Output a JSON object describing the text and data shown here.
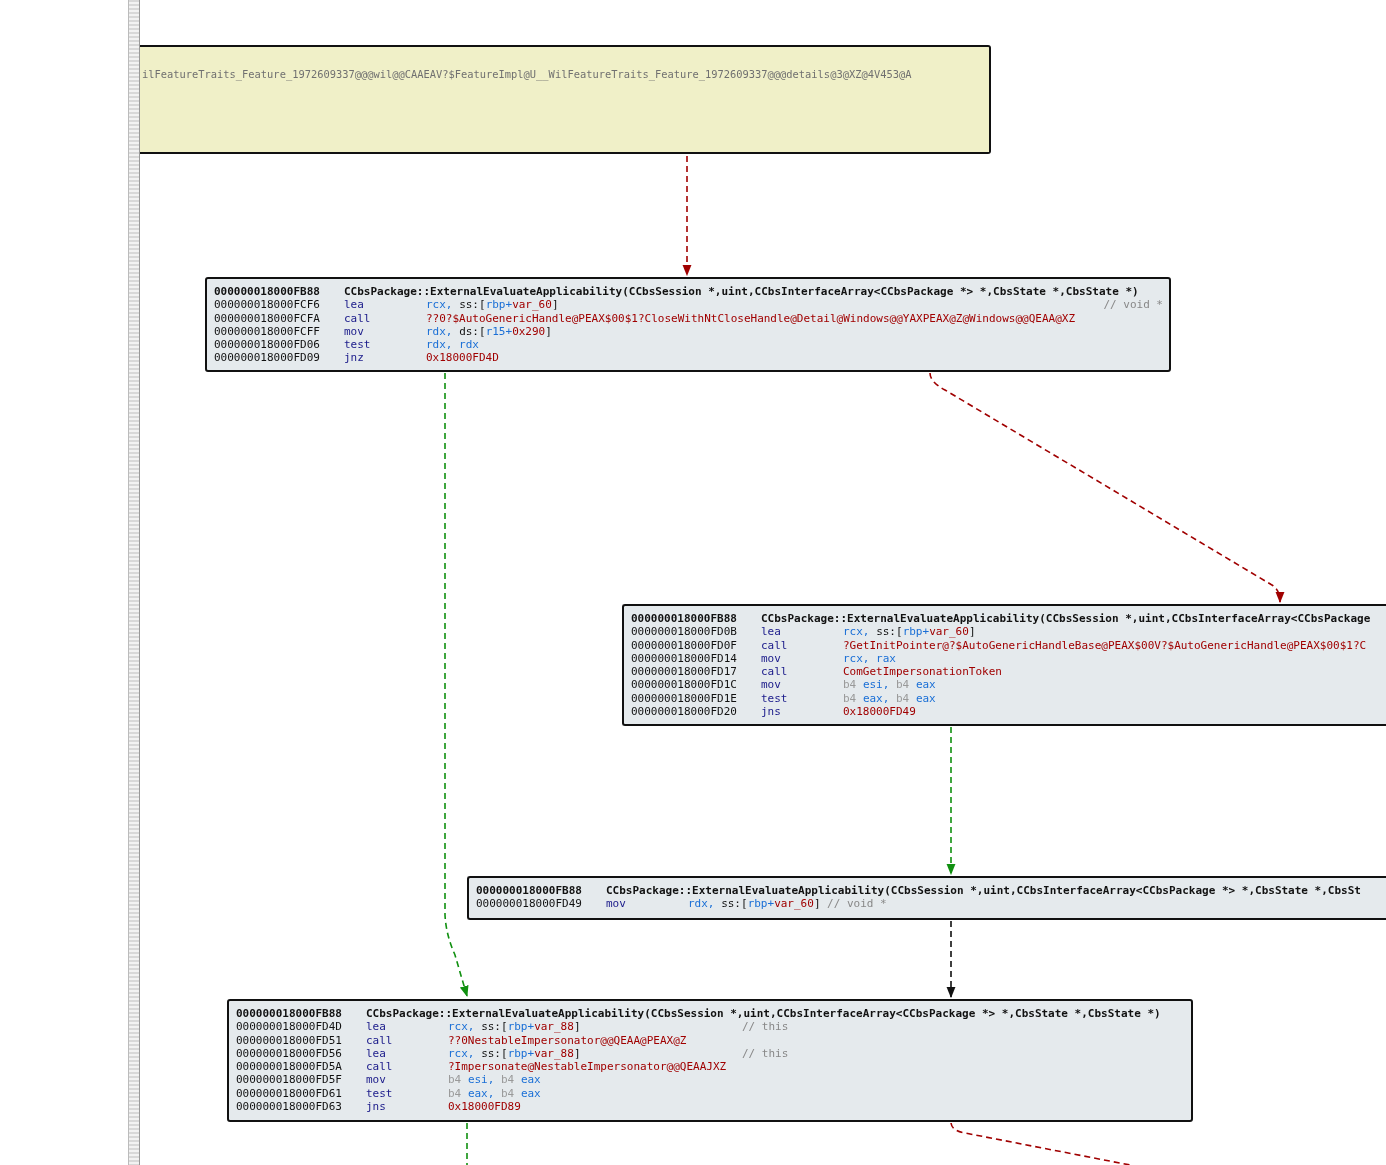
{
  "name_block": {
    "text": "ilFeatureTraits_Feature_1972609337@@@wil@@CAAEAV?$FeatureImpl@U__WilFeatureTraits_Feature_1972609337@@@details@3@XZ@4V453@A"
  },
  "blocks": [
    {
      "header": {
        "address": "000000018000FB88",
        "name": "CCbsPackage::ExternalEvaluateApplicability(CCbsSession *,uint,CCbsInterfaceArray<CCbsPackage *> *,CbsState *,CbsState *)"
      },
      "lines": [
        {
          "address": "000000018000FCF6",
          "mnemonic": "lea",
          "operand": [
            {
              "kind": "reg",
              "text": "rcx, "
            },
            {
              "kind": "text",
              "text": "ss:["
            },
            {
              "kind": "reg",
              "text": "rbp+"
            },
            {
              "kind": "sym",
              "text": "var_60"
            },
            {
              "kind": "text",
              "text": "]"
            }
          ],
          "comment": "// void *"
        },
        {
          "address": "000000018000FCFA",
          "mnemonic": "call",
          "operand": [
            {
              "kind": "sym",
              "text": "??0?$AutoGenericHandle@PEAX$00$1?CloseWithNtCloseHandle@Detail@Windows@@YAXPEAX@Z@Windows@@QEAA@XZ"
            }
          ]
        },
        {
          "address": "000000018000FCFF",
          "mnemonic": "mov",
          "operand": [
            {
              "kind": "reg",
              "text": "rdx, "
            },
            {
              "kind": "text",
              "text": "ds:["
            },
            {
              "kind": "reg",
              "text": "r15+"
            },
            {
              "kind": "sym",
              "text": "0x290"
            },
            {
              "kind": "text",
              "text": "]"
            }
          ]
        },
        {
          "address": "000000018000FD06",
          "mnemonic": "test",
          "operand": [
            {
              "kind": "reg",
              "text": "rdx, rdx"
            }
          ]
        },
        {
          "address": "000000018000FD09",
          "mnemonic": "jnz",
          "operand": [
            {
              "kind": "sym",
              "text": "0x18000FD4D"
            }
          ]
        }
      ]
    },
    {
      "header": {
        "address": "000000018000FB88",
        "name": "CCbsPackage::ExternalEvaluateApplicability(CCbsSession *,uint,CCbsInterfaceArray<CCbsPackage"
      },
      "lines": [
        {
          "address": "000000018000FD0B",
          "mnemonic": "lea",
          "operand": [
            {
              "kind": "reg",
              "text": "rcx, "
            },
            {
              "kind": "text",
              "text": "ss:["
            },
            {
              "kind": "reg",
              "text": "rbp+"
            },
            {
              "kind": "sym",
              "text": "var_60"
            },
            {
              "kind": "text",
              "text": "]"
            }
          ]
        },
        {
          "address": "000000018000FD0F",
          "mnemonic": "call",
          "operand": [
            {
              "kind": "sym",
              "text": "?GetInitPointer@?$AutoGenericHandleBase@PEAX$00V?$AutoGenericHandle@PEAX$00$1?C"
            }
          ]
        },
        {
          "address": "000000018000FD14",
          "mnemonic": "mov",
          "operand": [
            {
              "kind": "reg",
              "text": "rcx, rax"
            }
          ]
        },
        {
          "address": "000000018000FD17",
          "mnemonic": "call",
          "operand": [
            {
              "kind": "sym",
              "text": "ComGetImpersonationToken"
            }
          ]
        },
        {
          "address": "000000018000FD1C",
          "mnemonic": "mov",
          "operand": [
            {
              "kind": "dim",
              "text": "b4 "
            },
            {
              "kind": "reg",
              "text": "esi, "
            },
            {
              "kind": "dim",
              "text": "b4 "
            },
            {
              "kind": "reg",
              "text": "eax"
            }
          ]
        },
        {
          "address": "000000018000FD1E",
          "mnemonic": "test",
          "operand": [
            {
              "kind": "dim",
              "text": "b4 "
            },
            {
              "kind": "reg",
              "text": "eax, "
            },
            {
              "kind": "dim",
              "text": "b4 "
            },
            {
              "kind": "reg",
              "text": "eax"
            }
          ]
        },
        {
          "address": "000000018000FD20",
          "mnemonic": "jns",
          "operand": [
            {
              "kind": "sym",
              "text": "0x18000FD49"
            }
          ]
        }
      ]
    },
    {
      "header": {
        "address": "000000018000FB88",
        "name": "CCbsPackage::ExternalEvaluateApplicability(CCbsSession *,uint,CCbsInterfaceArray<CCbsPackage *> *,CbsState *,CbsSt"
      },
      "lines": [
        {
          "address": "000000018000FD49",
          "mnemonic": "mov",
          "operand": [
            {
              "kind": "reg",
              "text": "rdx, "
            },
            {
              "kind": "text",
              "text": "ss:["
            },
            {
              "kind": "reg",
              "text": "rbp+"
            },
            {
              "kind": "sym",
              "text": "var_60"
            },
            {
              "kind": "text",
              "text": "]"
            }
          ],
          "comment": "// void *"
        }
      ]
    },
    {
      "header": {
        "address": "000000018000FB88",
        "name": "CCbsPackage::ExternalEvaluateApplicability(CCbsSession *,uint,CCbsInterfaceArray<CCbsPackage *> *,CbsState *,CbsState *)"
      },
      "lines": [
        {
          "address": "000000018000FD4D",
          "mnemonic": "lea",
          "operand": [
            {
              "kind": "reg",
              "text": "rcx, "
            },
            {
              "kind": "text",
              "text": "ss:["
            },
            {
              "kind": "reg",
              "text": "rbp+"
            },
            {
              "kind": "sym",
              "text": "var_88"
            },
            {
              "kind": "text",
              "text": "]"
            }
          ],
          "comment": "// this"
        },
        {
          "address": "000000018000FD51",
          "mnemonic": "call",
          "operand": [
            {
              "kind": "sym",
              "text": "??0NestableImpersonator@@QEAA@PEAX@Z"
            }
          ]
        },
        {
          "address": "000000018000FD56",
          "mnemonic": "lea",
          "operand": [
            {
              "kind": "reg",
              "text": "rcx, "
            },
            {
              "kind": "text",
              "text": "ss:["
            },
            {
              "kind": "reg",
              "text": "rbp+"
            },
            {
              "kind": "sym",
              "text": "var_88"
            },
            {
              "kind": "text",
              "text": "]"
            }
          ],
          "comment": "// this"
        },
        {
          "address": "000000018000FD5A",
          "mnemonic": "call",
          "operand": [
            {
              "kind": "sym",
              "text": "?Impersonate@NestableImpersonator@@QEAAJXZ"
            }
          ]
        },
        {
          "address": "000000018000FD5F",
          "mnemonic": "mov",
          "operand": [
            {
              "kind": "dim",
              "text": "b4 "
            },
            {
              "kind": "reg",
              "text": "esi, "
            },
            {
              "kind": "dim",
              "text": "b4 "
            },
            {
              "kind": "reg",
              "text": "eax"
            }
          ]
        },
        {
          "address": "000000018000FD61",
          "mnemonic": "test",
          "operand": [
            {
              "kind": "dim",
              "text": "b4 "
            },
            {
              "kind": "reg",
              "text": "eax, "
            },
            {
              "kind": "dim",
              "text": "b4 "
            },
            {
              "kind": "reg",
              "text": "eax"
            }
          ]
        },
        {
          "address": "000000018000FD63",
          "mnemonic": "jns",
          "operand": [
            {
              "kind": "sym",
              "text": "0x18000FD89"
            }
          ]
        }
      ]
    }
  ],
  "edges": [
    {
      "kind": "no"
    },
    {
      "kind": "yes"
    },
    {
      "kind": "no"
    },
    {
      "kind": "yes"
    },
    {
      "kind": "always"
    },
    {
      "kind": "no"
    },
    {
      "kind": "yes"
    }
  ]
}
